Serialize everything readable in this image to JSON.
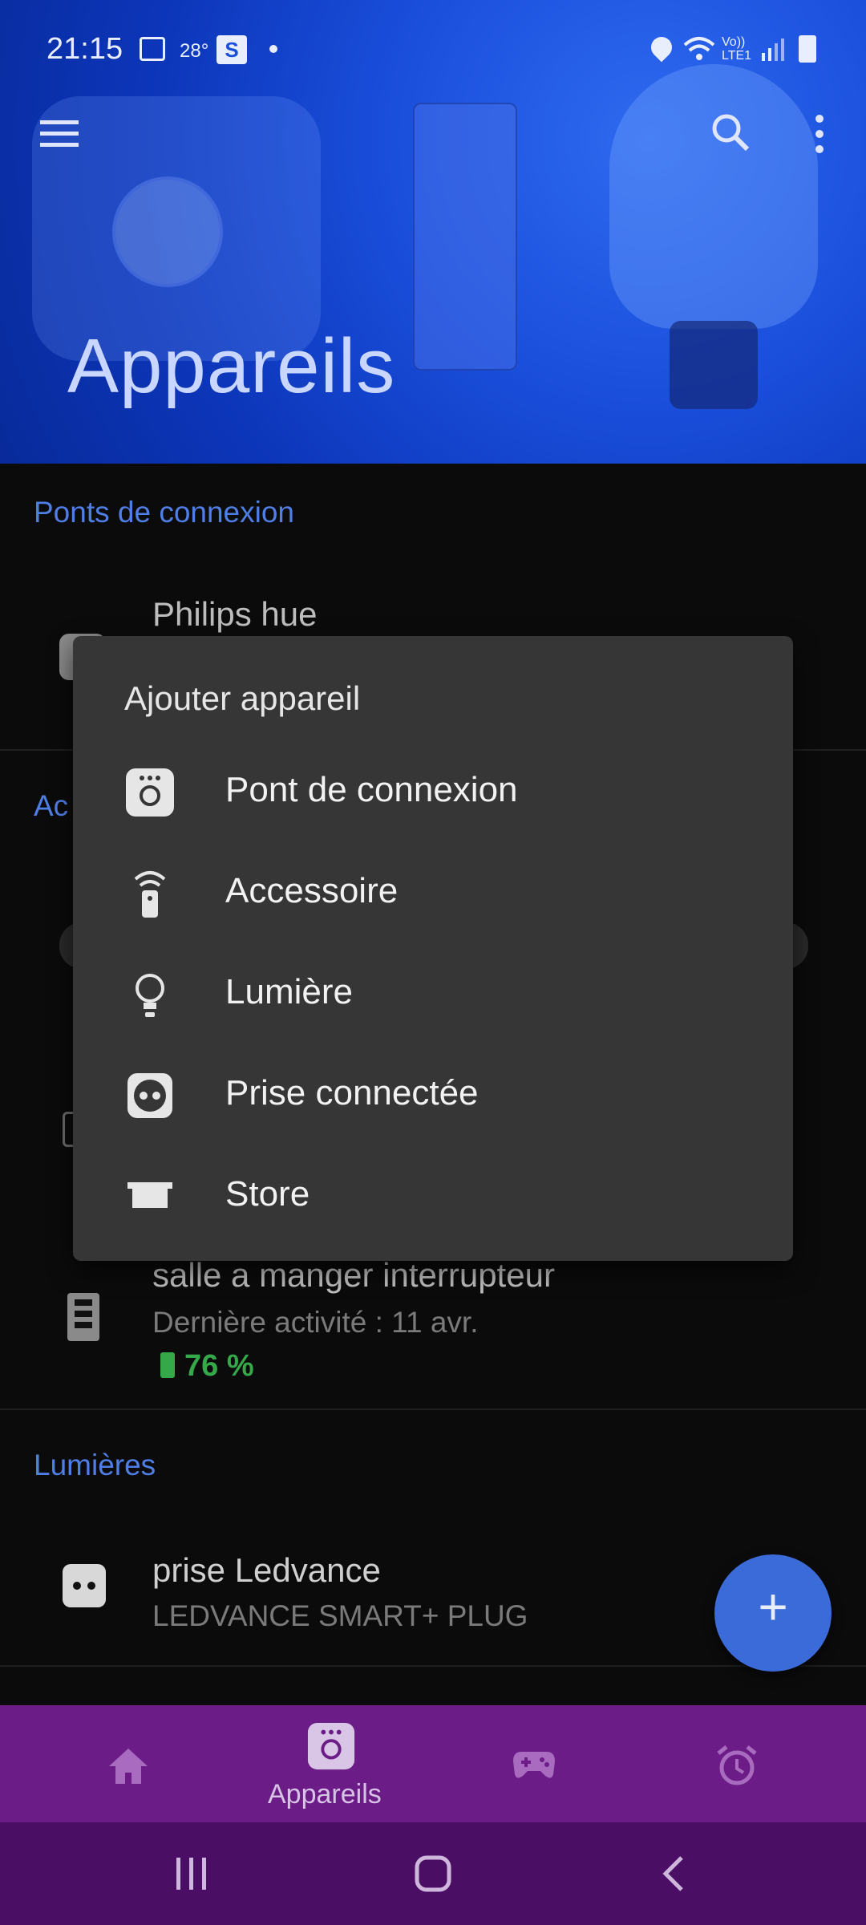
{
  "status_bar": {
    "time": "21:15",
    "temp": "28°",
    "carrier_badge": "S"
  },
  "header": {
    "title": "Appareils",
    "menu_icon": "hamburger-icon",
    "search_icon": "search-icon",
    "more_icon": "more-vertical-icon"
  },
  "sections": {
    "bridges_title": "Ponts de connexion",
    "bridge_item_name": "Philips hue",
    "accessories_title_partial": "Ac",
    "switch_name": "salle a manger interrupteur",
    "switch_activity": "Dernière activité : 11 avr.",
    "switch_battery": "76 %",
    "lights_title": "Lumières",
    "plug_name": "prise Ledvance",
    "plug_model": "LEDVANCE SMART+ PLUG"
  },
  "dialog": {
    "title": "Ajouter appareil",
    "items": [
      {
        "label": "Pont de connexion",
        "icon": "bridge-icon"
      },
      {
        "label": "Accessoire",
        "icon": "remote-icon"
      },
      {
        "label": "Lumière",
        "icon": "bulb-icon"
      },
      {
        "label": "Prise connectée",
        "icon": "plug-icon"
      },
      {
        "label": "Store",
        "icon": "blind-icon"
      }
    ]
  },
  "fab": {
    "label": "+"
  },
  "bottom_nav": {
    "active_label": "Appareils"
  },
  "colors": {
    "accent": "#4f7fe6",
    "battery": "#35a94a",
    "nav_bg": "#6c1c86"
  }
}
